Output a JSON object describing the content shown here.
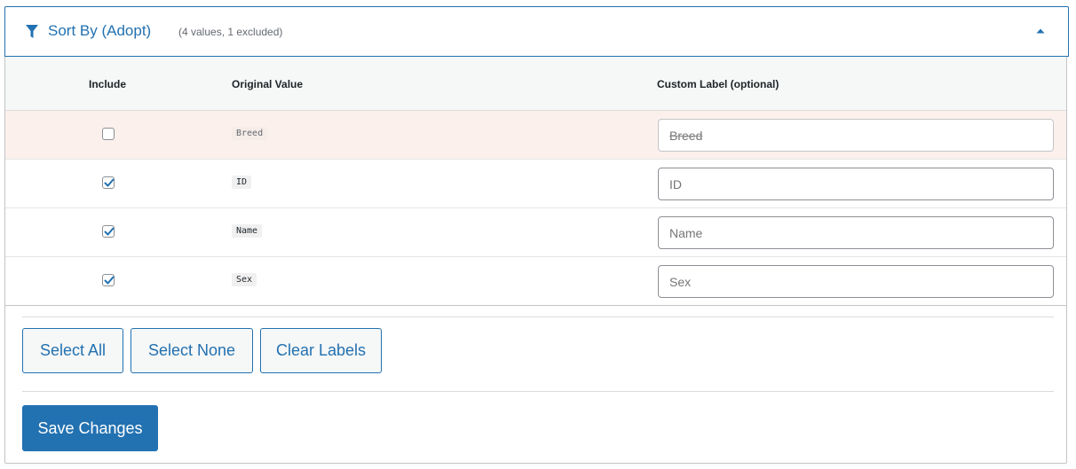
{
  "header": {
    "title": "Sort By (Adopt)",
    "subtitle": "(4 values, 1 excluded)"
  },
  "table": {
    "columns": {
      "include": "Include",
      "original": "Original Value",
      "custom": "Custom Label (optional)"
    },
    "rows": [
      {
        "include": false,
        "original": "Breed",
        "label_value": "",
        "label_placeholder": "Breed"
      },
      {
        "include": true,
        "original": "ID",
        "label_value": "",
        "label_placeholder": "ID"
      },
      {
        "include": true,
        "original": "Name",
        "label_value": "",
        "label_placeholder": "Name"
      },
      {
        "include": true,
        "original": "Sex",
        "label_value": "",
        "label_placeholder": "Sex"
      }
    ]
  },
  "actions": {
    "select_all": "Select All",
    "select_none": "Select None",
    "clear_labels": "Clear Labels",
    "save": "Save Changes"
  },
  "colors": {
    "accent": "#2271b1",
    "excluded_row_bg": "#fcf0ec"
  },
  "icons": {
    "header": "filter-icon",
    "collapse": "caret-up-icon",
    "checkbox_check": "check-icon"
  }
}
